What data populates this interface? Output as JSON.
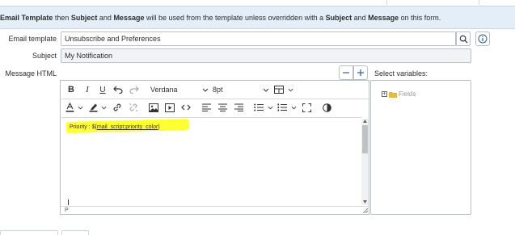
{
  "info_message": {
    "part1": "Email Template",
    "part2": " then ",
    "part3": "Subject",
    "part4": " and ",
    "part5": "Message",
    "part6": " will be used from the template unless overridden with a ",
    "part7": "Subject",
    "part8": " and ",
    "part9": "Message",
    "part10": " on this form."
  },
  "form": {
    "email_template_label": "Email template",
    "email_template_value": "Unsubscribe and Preferences",
    "subject_label": "Subject",
    "subject_value": "My Notification",
    "message_html_label": "Message HTML",
    "select_variables_label": "Select variables:"
  },
  "toolbar": {
    "bold": "B",
    "italic": "I",
    "underline": "U",
    "font_family": "Verdana",
    "font_size": "8pt"
  },
  "editor": {
    "body_prefix": "Priority : ${",
    "body_link": "mail_script:priority_color",
    "body_suffix": "}",
    "status_path": "P"
  },
  "variables_tree": {
    "root_label": "Fields",
    "root_expander": "+"
  },
  "colors": {
    "info_bg": "#e4eef8",
    "highlight": "#ffff33",
    "folder": "#e8b93a"
  }
}
